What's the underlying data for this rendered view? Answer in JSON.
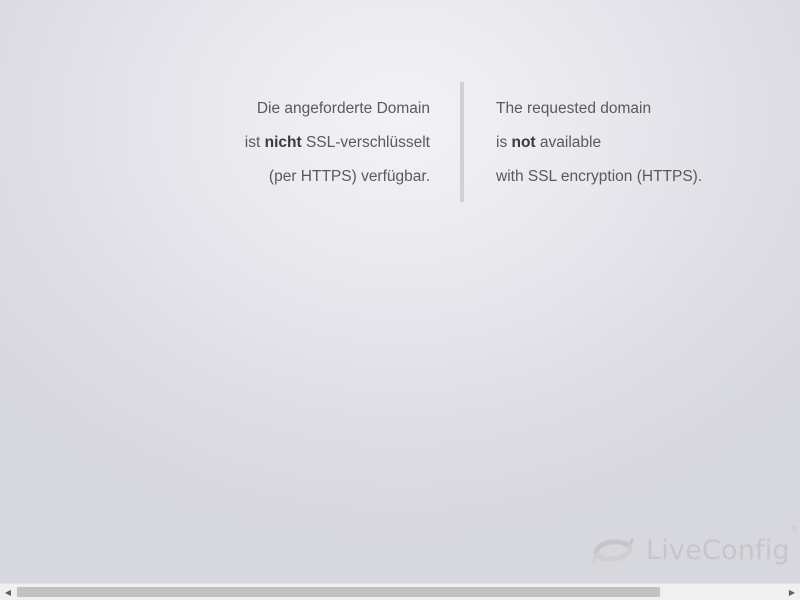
{
  "message": {
    "de": {
      "line1": "Die angeforderte Domain",
      "line2_prefix": "ist ",
      "line2_bold": "nicht",
      "line2_suffix": " SSL-verschlüsselt",
      "line3": "(per HTTPS) verfügbar."
    },
    "en": {
      "line1": "The requested domain",
      "line2_prefix": "is ",
      "line2_bold": "not",
      "line2_suffix": " available",
      "line3": "with SSL encryption (HTTPS)."
    }
  },
  "logo": {
    "text": "LiveConfig",
    "registered": "®",
    "icon": "liveconfig-logo-icon",
    "color": "#c4c4ca"
  },
  "scrollbar": {
    "left_arrow": "◀",
    "right_arrow": "▶",
    "thumb_position": 0.0,
    "thumb_fraction": 0.84
  },
  "colors": {
    "text": "#5a5a5a",
    "background": "#e4e4ea",
    "divider": "#d0d0d6"
  }
}
